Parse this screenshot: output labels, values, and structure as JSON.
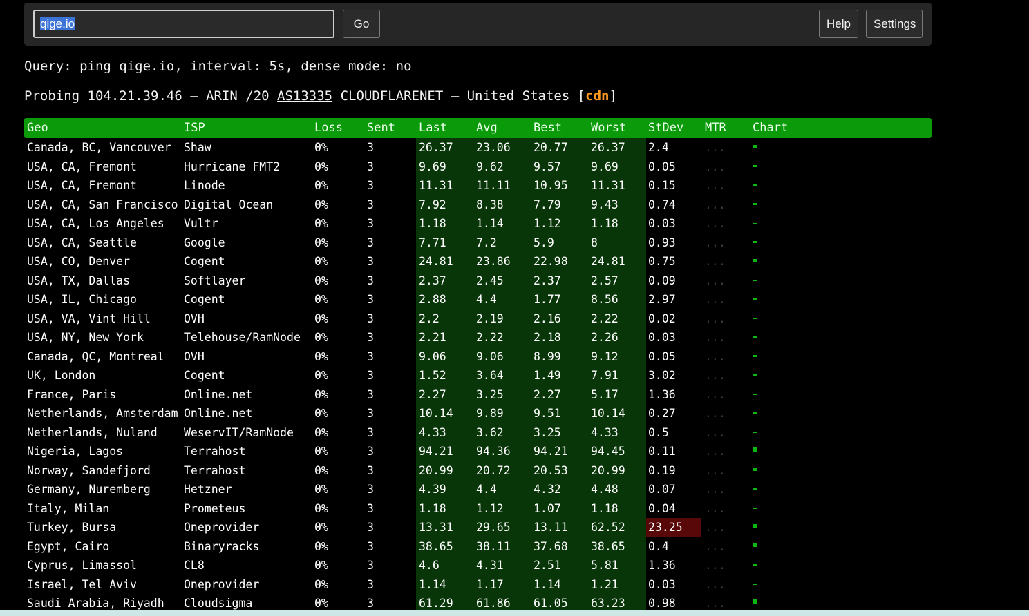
{
  "toolbar": {
    "query_value": "qige.io",
    "go_label": "Go",
    "help_label": "Help",
    "settings_label": "Settings"
  },
  "query_line": "Query: ping qige.io, interval: 5s, dense mode: no",
  "probing": {
    "prefix": "Probing 104.21.39.46 — ARIN /20 ",
    "asn": "AS13335",
    "middle": " CLOUDFLARENET — United States [",
    "tag": "cdn",
    "suffix": "]"
  },
  "columns": [
    "Geo",
    "ISP",
    "Loss",
    "Sent",
    "Last",
    "Avg",
    "Best",
    "Worst",
    "StDev",
    "MTR",
    "Chart"
  ],
  "colors": {
    "header_bg": "#0a9a0a",
    "latency_bg": "#093609",
    "stdev_alert_bg": "#580808",
    "accent_cdn": "#ff9a1f"
  },
  "mtr_placeholder": "...",
  "rows": [
    {
      "geo": "Canada, BC, Vancouver",
      "isp": "Shaw",
      "loss": "0%",
      "sent": "3",
      "last": "26.37",
      "avg": "23.06",
      "best": "20.77",
      "worst": "26.37",
      "stdev": "2.4"
    },
    {
      "geo": "USA, CA, Fremont",
      "isp": "Hurricane FMT2",
      "loss": "0%",
      "sent": "3",
      "last": "9.69",
      "avg": "9.62",
      "best": "9.57",
      "worst": "9.69",
      "stdev": "0.05"
    },
    {
      "geo": "USA, CA, Fremont",
      "isp": "Linode",
      "loss": "0%",
      "sent": "3",
      "last": "11.31",
      "avg": "11.11",
      "best": "10.95",
      "worst": "11.31",
      "stdev": "0.15"
    },
    {
      "geo": "USA, CA, San Francisco",
      "isp": "Digital Ocean",
      "loss": "0%",
      "sent": "3",
      "last": "7.92",
      "avg": "8.38",
      "best": "7.79",
      "worst": "9.43",
      "stdev": "0.74"
    },
    {
      "geo": "USA, CA, Los Angeles",
      "isp": "Vultr",
      "loss": "0%",
      "sent": "3",
      "last": "1.18",
      "avg": "1.14",
      "best": "1.12",
      "worst": "1.18",
      "stdev": "0.03"
    },
    {
      "geo": "USA, CA, Seattle",
      "isp": "Google",
      "loss": "0%",
      "sent": "3",
      "last": "7.71",
      "avg": "7.2",
      "best": "5.9",
      "worst": "8",
      "stdev": "0.93"
    },
    {
      "geo": "USA, CO, Denver",
      "isp": "Cogent",
      "loss": "0%",
      "sent": "3",
      "last": "24.81",
      "avg": "23.86",
      "best": "22.98",
      "worst": "24.81",
      "stdev": "0.75"
    },
    {
      "geo": "USA, TX, Dallas",
      "isp": "Softlayer",
      "loss": "0%",
      "sent": "3",
      "last": "2.37",
      "avg": "2.45",
      "best": "2.37",
      "worst": "2.57",
      "stdev": "0.09"
    },
    {
      "geo": "USA, IL, Chicago",
      "isp": "Cogent",
      "loss": "0%",
      "sent": "3",
      "last": "2.88",
      "avg": "4.4",
      "best": "1.77",
      "worst": "8.56",
      "stdev": "2.97"
    },
    {
      "geo": "USA, VA, Vint Hill",
      "isp": "OVH",
      "loss": "0%",
      "sent": "3",
      "last": "2.2",
      "avg": "2.19",
      "best": "2.16",
      "worst": "2.22",
      "stdev": "0.02"
    },
    {
      "geo": "USA, NY, New York",
      "isp": "Telehouse/RamNode",
      "loss": "0%",
      "sent": "3",
      "last": "2.21",
      "avg": "2.22",
      "best": "2.18",
      "worst": "2.26",
      "stdev": "0.03"
    },
    {
      "geo": "Canada, QC, Montreal",
      "isp": "OVH",
      "loss": "0%",
      "sent": "3",
      "last": "9.06",
      "avg": "9.06",
      "best": "8.99",
      "worst": "9.12",
      "stdev": "0.05"
    },
    {
      "geo": "UK, London",
      "isp": "Cogent",
      "loss": "0%",
      "sent": "3",
      "last": "1.52",
      "avg": "3.64",
      "best": "1.49",
      "worst": "7.91",
      "stdev": "3.02"
    },
    {
      "geo": "France, Paris",
      "isp": "Online.net",
      "loss": "0%",
      "sent": "3",
      "last": "2.27",
      "avg": "3.25",
      "best": "2.27",
      "worst": "5.17",
      "stdev": "1.36"
    },
    {
      "geo": "Netherlands, Amsterdam",
      "isp": "Online.net",
      "loss": "0%",
      "sent": "3",
      "last": "10.14",
      "avg": "9.89",
      "best": "9.51",
      "worst": "10.14",
      "stdev": "0.27"
    },
    {
      "geo": "Netherlands, Nuland",
      "isp": "WeservIT/RamNode",
      "loss": "0%",
      "sent": "3",
      "last": "4.33",
      "avg": "3.62",
      "best": "3.25",
      "worst": "4.33",
      "stdev": "0.5"
    },
    {
      "geo": "Nigeria, Lagos",
      "isp": "Terrahost",
      "loss": "0%",
      "sent": "3",
      "last": "94.21",
      "avg": "94.36",
      "best": "94.21",
      "worst": "94.45",
      "stdev": "0.11"
    },
    {
      "geo": "Norway, Sandefjord",
      "isp": "Terrahost",
      "loss": "0%",
      "sent": "3",
      "last": "20.99",
      "avg": "20.72",
      "best": "20.53",
      "worst": "20.99",
      "stdev": "0.19"
    },
    {
      "geo": "Germany, Nuremberg",
      "isp": "Hetzner",
      "loss": "0%",
      "sent": "3",
      "last": "4.39",
      "avg": "4.4",
      "best": "4.32",
      "worst": "4.48",
      "stdev": "0.07"
    },
    {
      "geo": "Italy, Milan",
      "isp": "Prometeus",
      "loss": "0%",
      "sent": "3",
      "last": "1.18",
      "avg": "1.12",
      "best": "1.07",
      "worst": "1.18",
      "stdev": "0.04"
    },
    {
      "geo": "Turkey, Bursa",
      "isp": "Oneprovider",
      "loss": "0%",
      "sent": "3",
      "last": "13.31",
      "avg": "29.65",
      "best": "13.11",
      "worst": "62.52",
      "stdev": "23.25",
      "alert": true
    },
    {
      "geo": "Egypt, Cairo",
      "isp": "Binaryracks",
      "loss": "0%",
      "sent": "3",
      "last": "38.65",
      "avg": "38.11",
      "best": "37.68",
      "worst": "38.65",
      "stdev": "0.4"
    },
    {
      "geo": "Cyprus, Limassol",
      "isp": "CL8",
      "loss": "0%",
      "sent": "3",
      "last": "4.6",
      "avg": "4.31",
      "best": "2.51",
      "worst": "5.81",
      "stdev": "1.36"
    },
    {
      "geo": "Israel, Tel Aviv",
      "isp": "Oneprovider",
      "loss": "0%",
      "sent": "3",
      "last": "1.14",
      "avg": "1.17",
      "best": "1.14",
      "worst": "1.21",
      "stdev": "0.03"
    },
    {
      "geo": "Saudi Arabia, Riyadh",
      "isp": "Cloudsigma",
      "loss": "0%",
      "sent": "3",
      "last": "61.29",
      "avg": "61.86",
      "best": "61.05",
      "worst": "63.23",
      "stdev": "0.98"
    }
  ]
}
